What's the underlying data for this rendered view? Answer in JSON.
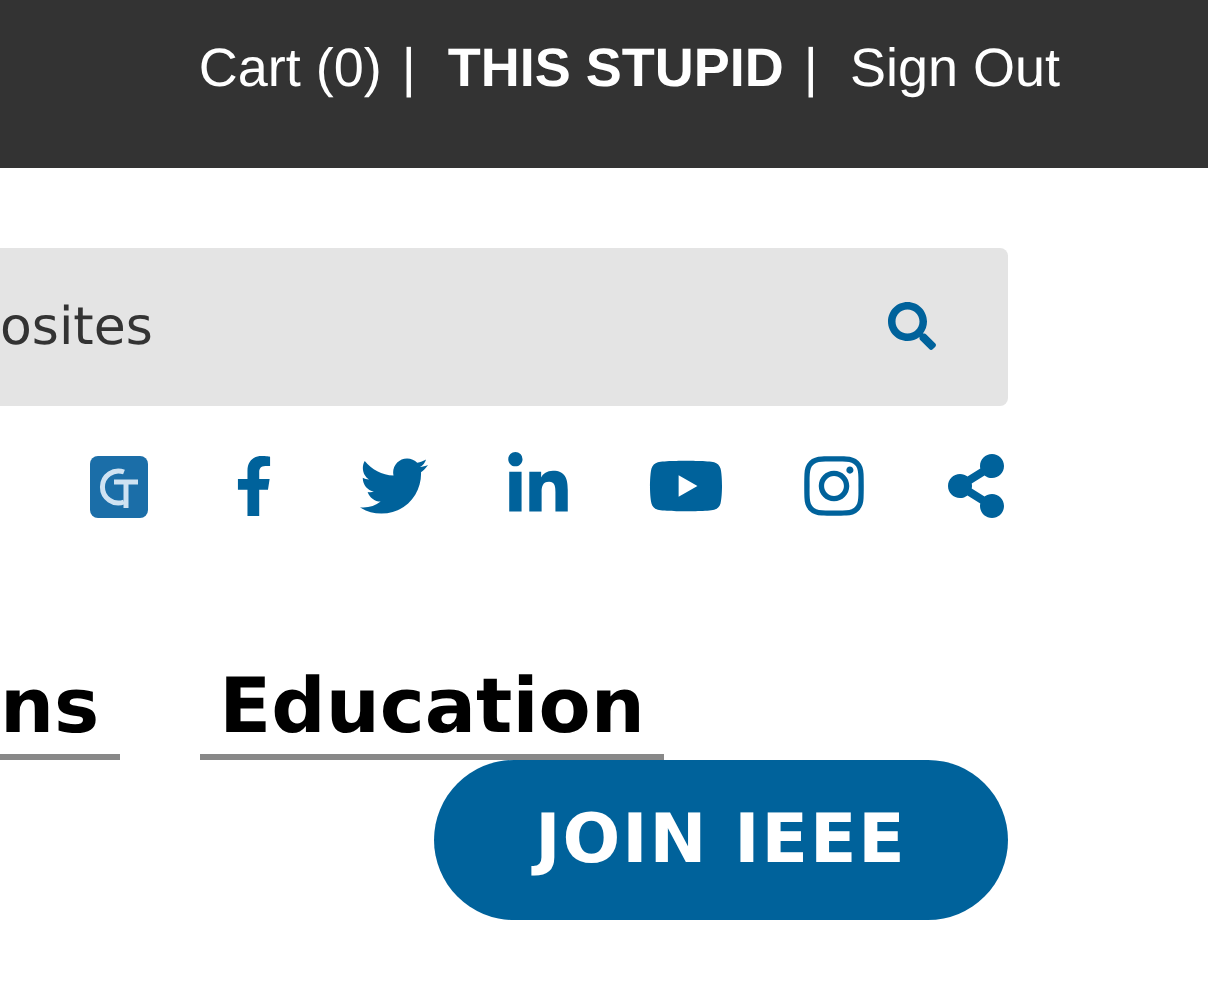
{
  "top_bar": {
    "links": [
      {
        "label": "Cart (0)",
        "kind": "link"
      },
      {
        "label": "|",
        "kind": "separator"
      },
      {
        "label": "THIS STUPID",
        "kind": "user"
      },
      {
        "label": "|",
        "kind": "separator"
      },
      {
        "label": "Sign Out",
        "kind": "link"
      }
    ]
  },
  "search": {
    "placeholder": "osites"
  },
  "social_icons": [
    {
      "kind": "gt"
    },
    {
      "kind": "facebook"
    },
    {
      "kind": "twitter"
    },
    {
      "kind": "linkedin"
    },
    {
      "kind": "youtube"
    },
    {
      "kind": "instagram"
    },
    {
      "kind": "share"
    }
  ],
  "nav": {
    "items": [
      {
        "label": "ns"
      },
      {
        "label": "Education"
      }
    ]
  },
  "join_button": {
    "label": "JOIN IEEE"
  }
}
